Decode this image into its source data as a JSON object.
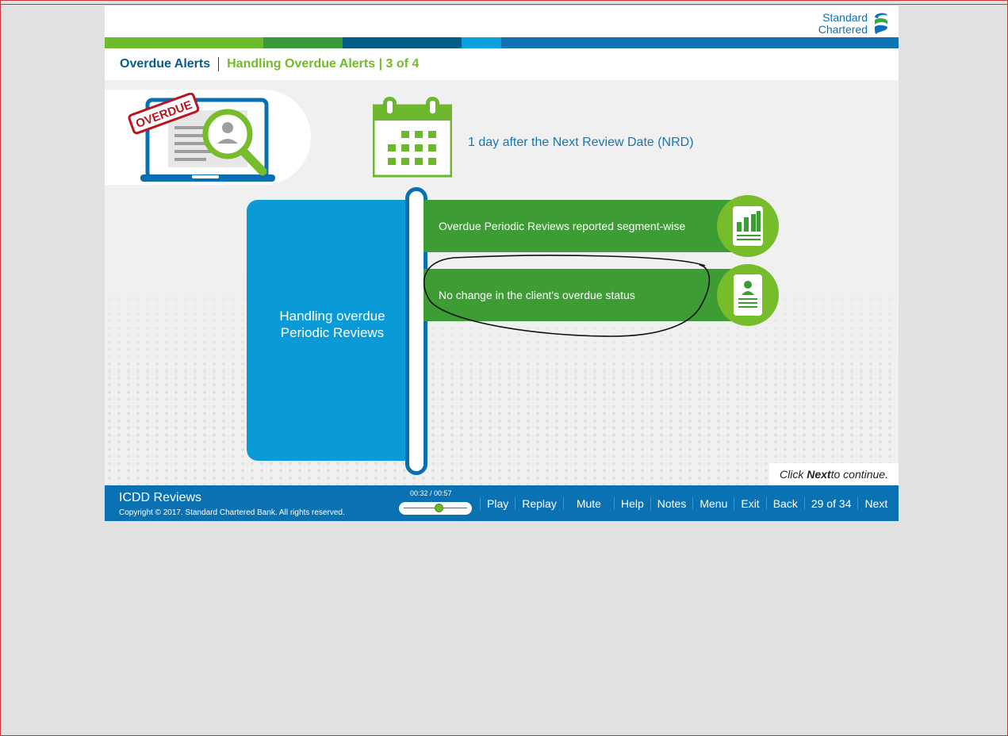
{
  "brand": {
    "name_line1": "Standard",
    "name_line2": "Chartered"
  },
  "colors": {
    "stripe": [
      "#6cbd2d",
      "#3a9a3a",
      "#005e86",
      "#0aa0dc",
      "#0f72b5"
    ],
    "brand_blue": "#0a72b3",
    "brand_green": "#3e9c35"
  },
  "title": {
    "main": "Overdue Alerts",
    "sub": "Handling Overdue Alerts | 3 of 4"
  },
  "graphic": {
    "stamp": "OVERDUE"
  },
  "trigger_text": "1 day after the Next Review Date (NRD)",
  "central_box": {
    "line1": "Handling overdue",
    "line2": "Periodic Reviews"
  },
  "items": [
    {
      "label": "Overdue Periodic Reviews reported segment-wise",
      "icon": "report-chart-icon"
    },
    {
      "label": "No change in the client's overdue status",
      "icon": "client-profile-icon"
    }
  ],
  "prompt": {
    "pre": "Click ",
    "bold": "Next",
    "post": " to continue."
  },
  "footer": {
    "course": "ICDD Reviews",
    "copyright": "Copyright © 2017. Standard Chartered Bank. All rights reserved.",
    "time": "00:32 / 00:57",
    "progress": 0.56,
    "nav": {
      "play": "Play",
      "replay": "Replay",
      "mute": "Mute",
      "help": "Help",
      "notes": "Notes",
      "menu": "Menu",
      "exit": "Exit",
      "back": "Back",
      "page": "29 of 34",
      "next": "Next"
    }
  }
}
